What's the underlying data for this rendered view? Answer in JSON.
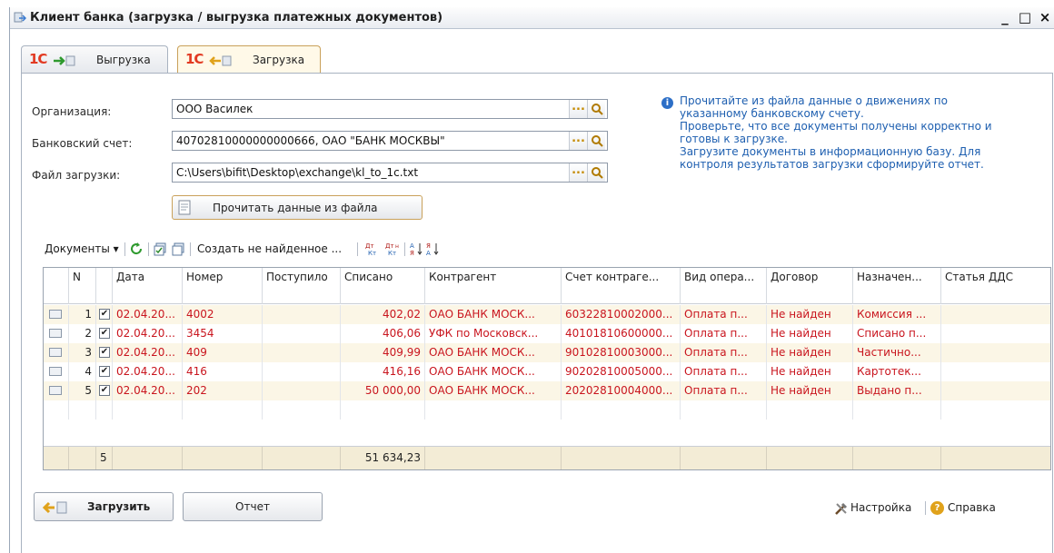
{
  "window": {
    "title": "Клиент банка (загрузка / выгрузка платежных документов)",
    "minimize": "_",
    "maximize": "□",
    "close": "×"
  },
  "tabs": [
    {
      "logo": "1С",
      "label": "Выгрузка",
      "active": false
    },
    {
      "logo": "1С",
      "label": "Загрузка",
      "active": true
    }
  ],
  "form": {
    "org_label": "Организация:",
    "org_value": "ООО Василек",
    "account_label": "Банковский счет:",
    "account_value": "40702810000000000666, ОАО \"БАНК МОСКВЫ\"",
    "file_label": "Файл загрузки:",
    "file_value": "C:\\Users\\bifit\\Desktop\\exchange\\kl_to_1c.txt",
    "dots": "...",
    "read_button": "Прочитать данные из файла"
  },
  "info": {
    "text": "Прочитайте из файла данные о движениях по указанному банковскому счету. Проверьте, что все документы получены корректно и готовы к загрузке. Загрузите документы в информационную базу. Для контроля результатов загрузки сформируйте отчет.",
    "lines": [
      "Прочитайте из файла данные о движениях по",
      "указанному банковскому счету.",
      "Проверьте, что все  документы получены корректно и",
      "готовы к загрузке.",
      "Загрузите документы в информационную базу. Для",
      "контроля результатов загрузки сформируйте отчет."
    ]
  },
  "toolbar": {
    "documents_menu": "Документы",
    "create_missing": "Создать не найденное ..."
  },
  "grid": {
    "columns": [
      "N",
      "",
      "Дата",
      "Номер",
      "Поступило",
      "Списано",
      "Контрагент",
      "Счет контраге...",
      "Вид опера...",
      "Договор",
      "Назначен...",
      "Статья ДДС"
    ],
    "rows": [
      {
        "n": "1",
        "date": "02.04.20...",
        "number": "4002",
        "received": "",
        "spent": "402,02",
        "counterparty": "ОАО БАНК МОСК...",
        "account": "60322810002000...",
        "operation": "Оплата п...",
        "contract": "Не найден",
        "purpose": "Комиссия ...",
        "dds": ""
      },
      {
        "n": "2",
        "date": "02.04.20...",
        "number": "3454",
        "received": "",
        "spent": "406,06",
        "counterparty": "УФК по Московск...",
        "account": "40101810600000...",
        "operation": "Оплата п...",
        "contract": "Не найден",
        "purpose": "Списано п...",
        "dds": ""
      },
      {
        "n": "3",
        "date": "02.04.20...",
        "number": "409",
        "received": "",
        "spent": "409,99",
        "counterparty": "ОАО БАНК МОСК...",
        "account": "90102810003000...",
        "operation": "Оплата п...",
        "contract": "Не найден",
        "purpose": "Частично...",
        "dds": ""
      },
      {
        "n": "4",
        "date": "02.04.20...",
        "number": "416",
        "received": "",
        "spent": "416,16",
        "counterparty": "ОАО БАНК МОСК...",
        "account": "90202810005000...",
        "operation": "Оплата п...",
        "contract": "Не найден",
        "purpose": "Картотек...",
        "dds": ""
      },
      {
        "n": "5",
        "date": "02.04.20...",
        "number": "202",
        "received": "",
        "spent": "50 000,00",
        "counterparty": "ОАО БАНК МОСК...",
        "account": "20202810004000...",
        "operation": "Оплата п...",
        "contract": "Не найден",
        "purpose": "Выдано п...",
        "dds": ""
      }
    ],
    "footer": {
      "count": "5",
      "spent_total": "51 634,23"
    }
  },
  "actions": {
    "load_button": "Загрузить",
    "report_button": "Отчет",
    "settings_link": "Настройка",
    "help_link": "Справка"
  },
  "colors": {
    "accent_red": "#c9151e",
    "info_blue": "#1e5fb0",
    "row_highlight": "#fbf6e6"
  }
}
